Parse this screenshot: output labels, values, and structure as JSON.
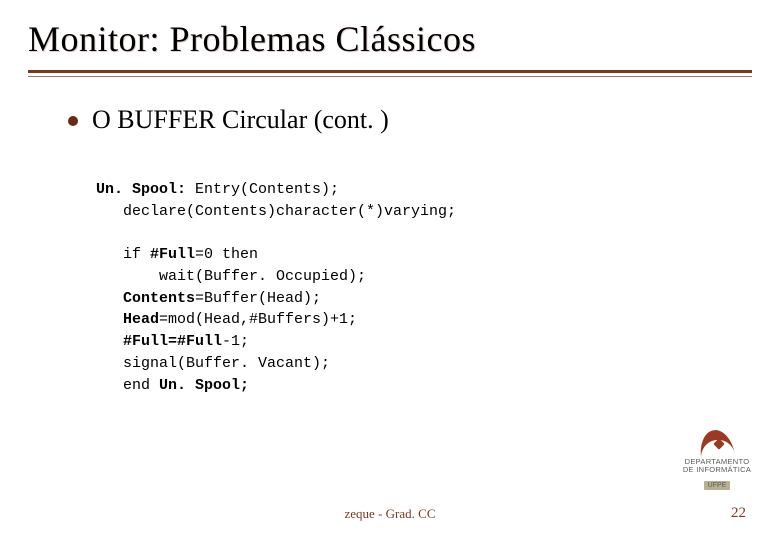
{
  "title": "Monitor: Problemas Clássicos",
  "bullet": "O BUFFER Circular (cont. )",
  "code": {
    "l1a": "Un. Spool:",
    "l1b": " Entry(Contents);",
    "l2": "   declare(Contents)character(*)varying;",
    "l3a": "   if ",
    "l3b": "#Full",
    "l3c": "=0 then",
    "l4": "       wait(Buffer. Occupied);",
    "l5a": "   ",
    "l5b": "Contents",
    "l5c": "=Buffer(Head);",
    "l6a": "   ",
    "l6b": "Head",
    "l6c": "=mod(Head,#Buffers)+1;",
    "l7a": "   ",
    "l7b": "#Full=#Full",
    "l7c": "-1;",
    "l8": "   signal(Buffer. Vacant);",
    "l9a": "   end ",
    "l9b": "Un. Spool;"
  },
  "logo": {
    "line1": "DEPARTAMENTO",
    "line2": "DE INFORMÁTICA",
    "tag": "UFPE"
  },
  "footer_center": "zeque - Grad. CC",
  "page_number": "22"
}
